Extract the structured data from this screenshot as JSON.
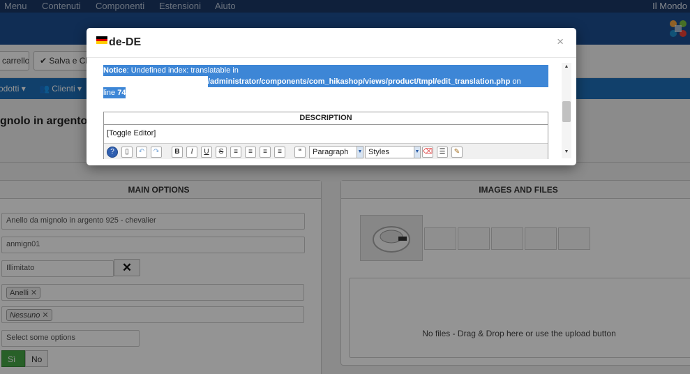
{
  "topbar": {
    "menu": [
      "Menu",
      "Contenuti",
      "Componenti",
      "Estensioni",
      "Aiuto"
    ],
    "site": "Il Mondo"
  },
  "toolbar": {
    "cart_label": "carrello",
    "save_close_label": "Salva e Chiudi"
  },
  "subnav": {
    "products": "odotti",
    "clients": "Clienti"
  },
  "page": {
    "title": "gnolo in argento"
  },
  "main_options": {
    "title": "MAIN OPTIONS",
    "name_value": "Anello da mignolo in argento 925 - chevalier",
    "code_value": "anmign01",
    "quantity_value": "Illimitato",
    "category_tag": "Anelli",
    "brand_tag": "Nessuno",
    "options_placeholder": "Select some options",
    "yes_label": "Sì",
    "no_label": "No"
  },
  "images": {
    "title": "IMAGES AND FILES",
    "no_files": "No files - Drag & Drop here or use the upload button"
  },
  "modal": {
    "title": "de-DE",
    "close_glyph": "×",
    "notice_label": "Notice",
    "notice_text": ": Undefined index: translatable in",
    "notice_path": "/administrator/components/com_hikashop/views/product/tmpl/edit_translation.php",
    "notice_on": " on",
    "notice_line_word": "line ",
    "notice_line_num": "74",
    "description_title": "DESCRIPTION",
    "toggle_editor": "[Toggle Editor]",
    "format_select": "Paragraph",
    "styles_select": "Styles"
  },
  "colors": {
    "highlight": "#3d86d6",
    "header_blue": "#1d4f91",
    "subnav_blue": "#1e6fb8",
    "yes_green": "#46a546"
  }
}
